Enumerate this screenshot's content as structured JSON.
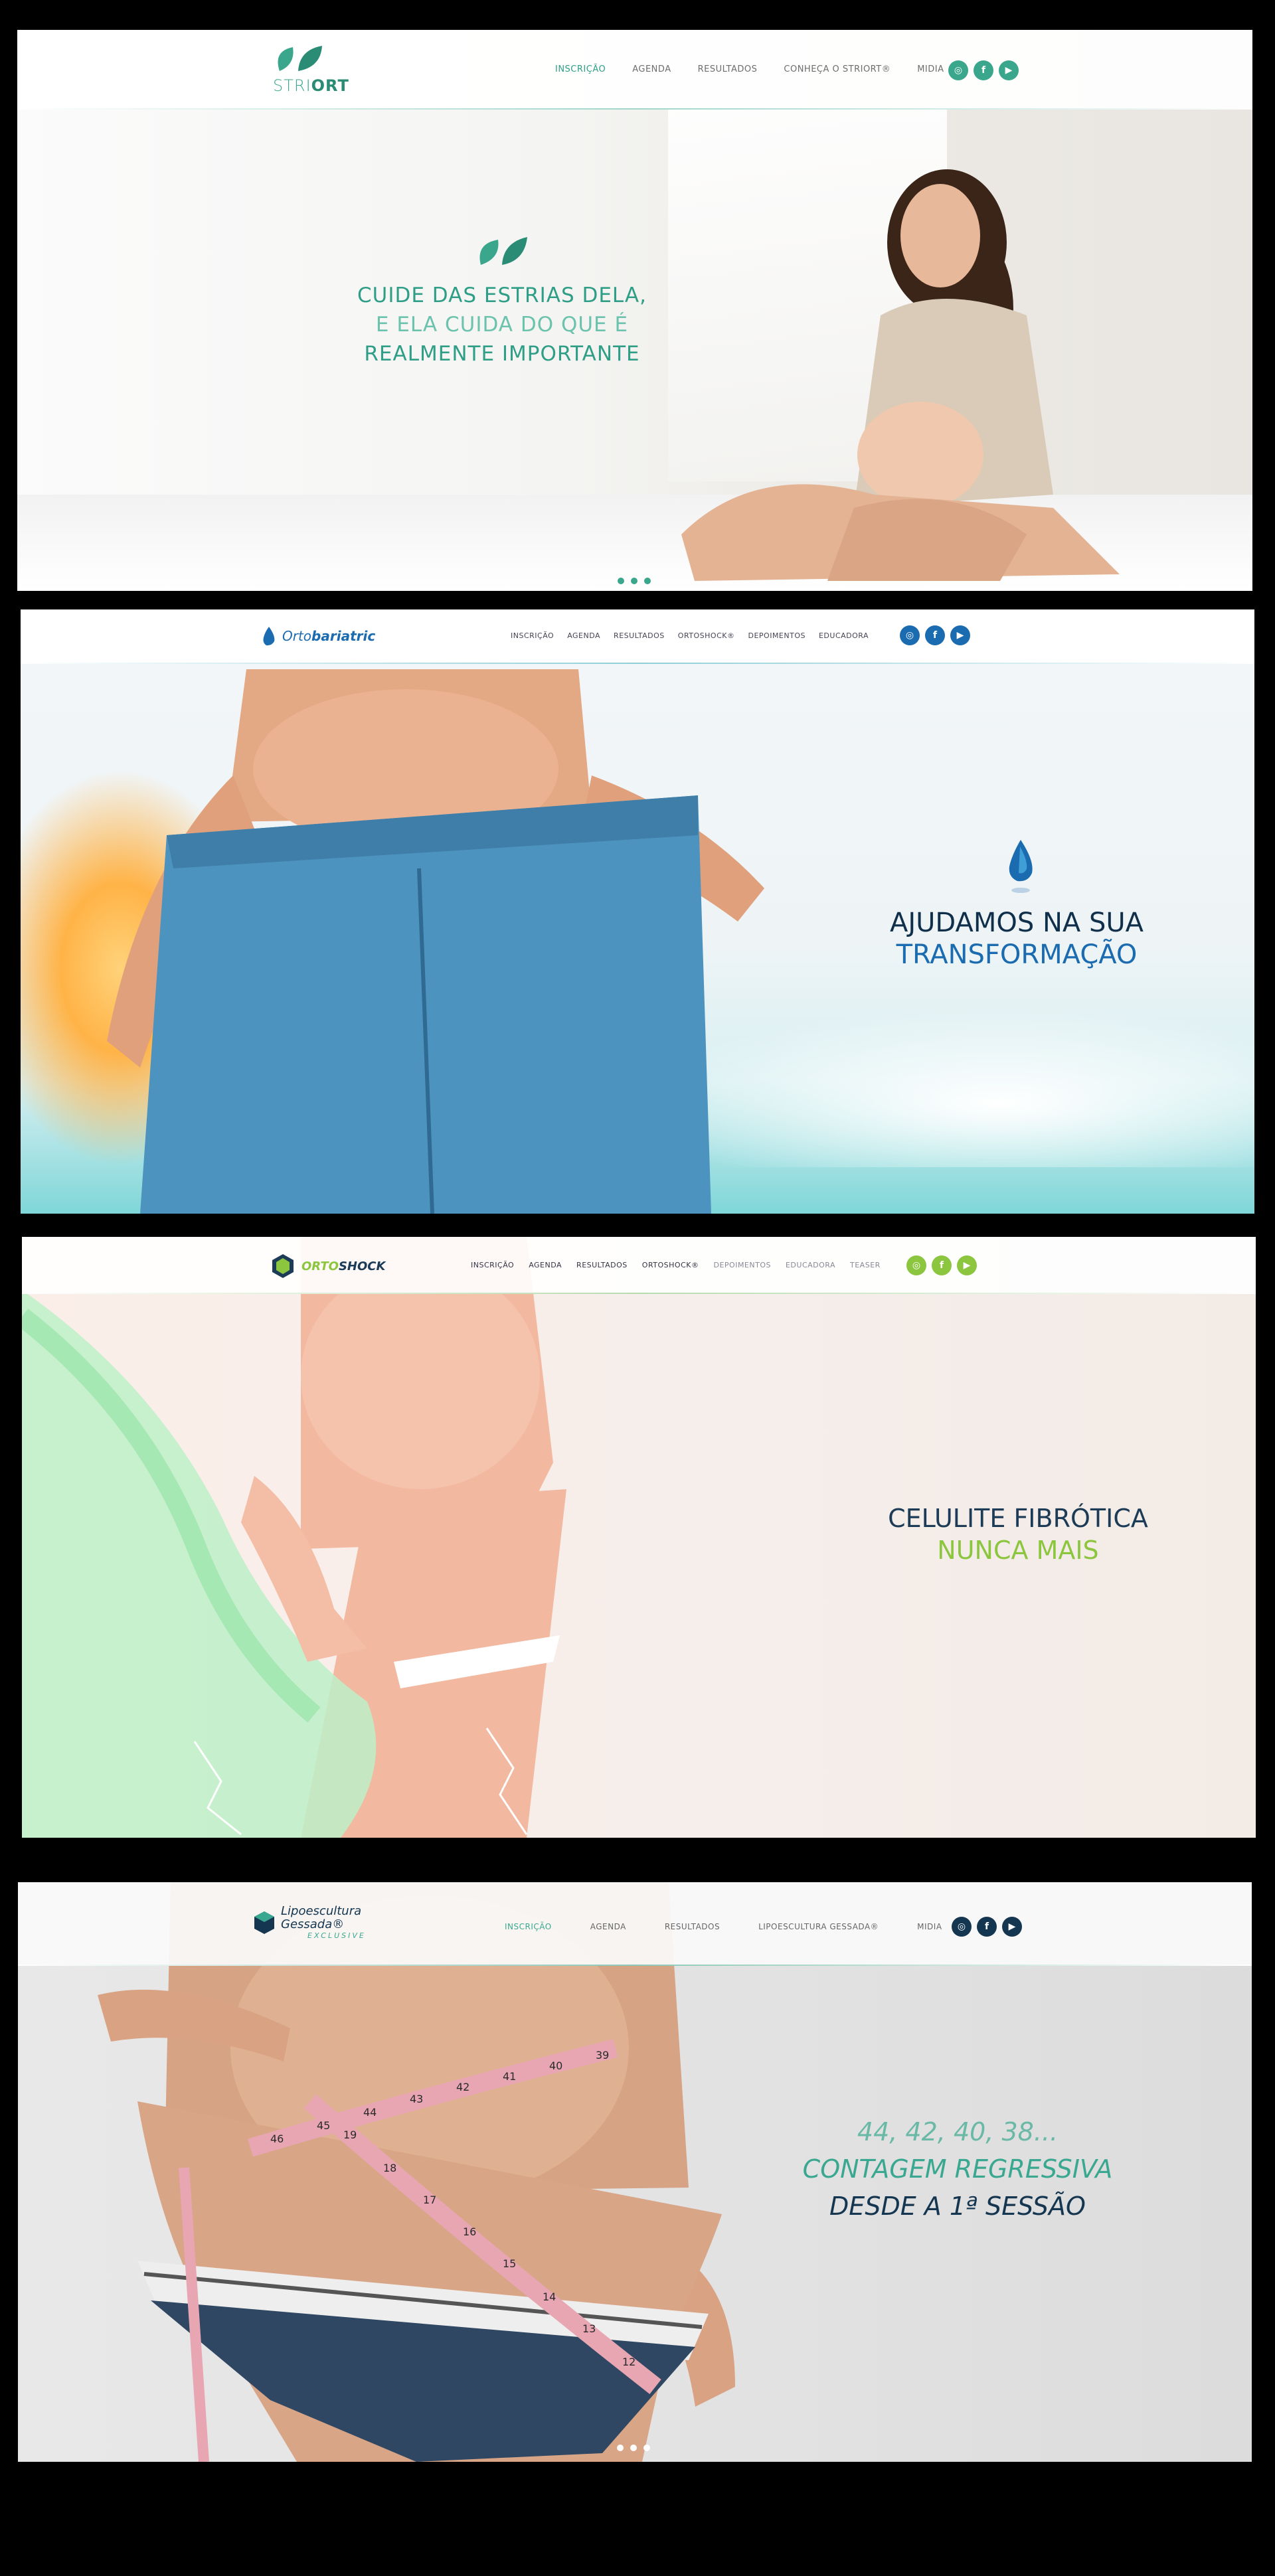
{
  "panels": [
    {
      "brand": "STRIORT",
      "brand_parts": [
        "STRI",
        "ORT"
      ],
      "nav": [
        "INSCRIÇÃO",
        "AGENDA",
        "RESULTADOS",
        "CONHEÇA O STRIORT®",
        "MIDIA"
      ],
      "socials": [
        "instagram-icon",
        "facebook-icon",
        "youtube-icon"
      ],
      "headline": [
        "CUIDE DAS ESTRIAS DELA,",
        "E ELA CUIDA DO QUE É",
        "REALMENTE IMPORTANTE"
      ],
      "colors": {
        "accent": "#2e9e86",
        "accent_light": "#6cc3ad"
      }
    },
    {
      "brand": "Ortobariatric",
      "brand_parts": [
        "Orto",
        "bariatric"
      ],
      "nav": [
        "INSCRIÇÃO",
        "AGENDA",
        "RESULTADOS",
        "ORTOSHOCK®",
        "DEPOIMENTOS",
        "EDUCADORA"
      ],
      "socials": [
        "instagram-icon",
        "facebook-icon",
        "youtube-icon"
      ],
      "headline": [
        "AJUDAMOS NA SUA",
        "TRANSFORMAÇÃO"
      ],
      "colors": {
        "accent": "#1a6bb0",
        "dark": "#0f2f4a"
      }
    },
    {
      "brand": "ORTOSHOCK",
      "brand_parts": [
        "ORTO",
        "SHOCK"
      ],
      "nav": [
        "INSCRIÇÃO",
        "AGENDA",
        "RESULTADOS",
        "ORTOSHOCK®",
        "DEPOIMENTOS",
        "EDUCADORA",
        "TEASER"
      ],
      "socials": [
        "instagram-icon",
        "facebook-icon",
        "youtube-icon"
      ],
      "headline": [
        "CELULITE FIBRÓTICA",
        "NUNCA MAIS"
      ],
      "colors": {
        "accent": "#8cc63f",
        "dark": "#1c3b57"
      }
    },
    {
      "brand": "Lipoescultura Gessada®",
      "brand_sub": "EXCLUSIVE",
      "nav": [
        "INSCRIÇÃO",
        "AGENDA",
        "RESULTADOS",
        "LIPOESCULTURA GESSADA®",
        "MIDIA"
      ],
      "socials": [
        "instagram-icon",
        "facebook-icon",
        "youtube-icon"
      ],
      "headline": [
        "44, 42, 40, 38...",
        "CONTAGEM REGRESSIVA",
        "DESDE A 1ª SESSÃO"
      ],
      "tape_numbers": [
        "46",
        "45",
        "44",
        "43",
        "42",
        "41",
        "40",
        "39"
      ],
      "tape_numbers_low": [
        "19",
        "18",
        "17",
        "16",
        "15",
        "14",
        "13",
        "12"
      ],
      "colors": {
        "accent": "#3aa890",
        "dark": "#153650"
      }
    }
  ]
}
